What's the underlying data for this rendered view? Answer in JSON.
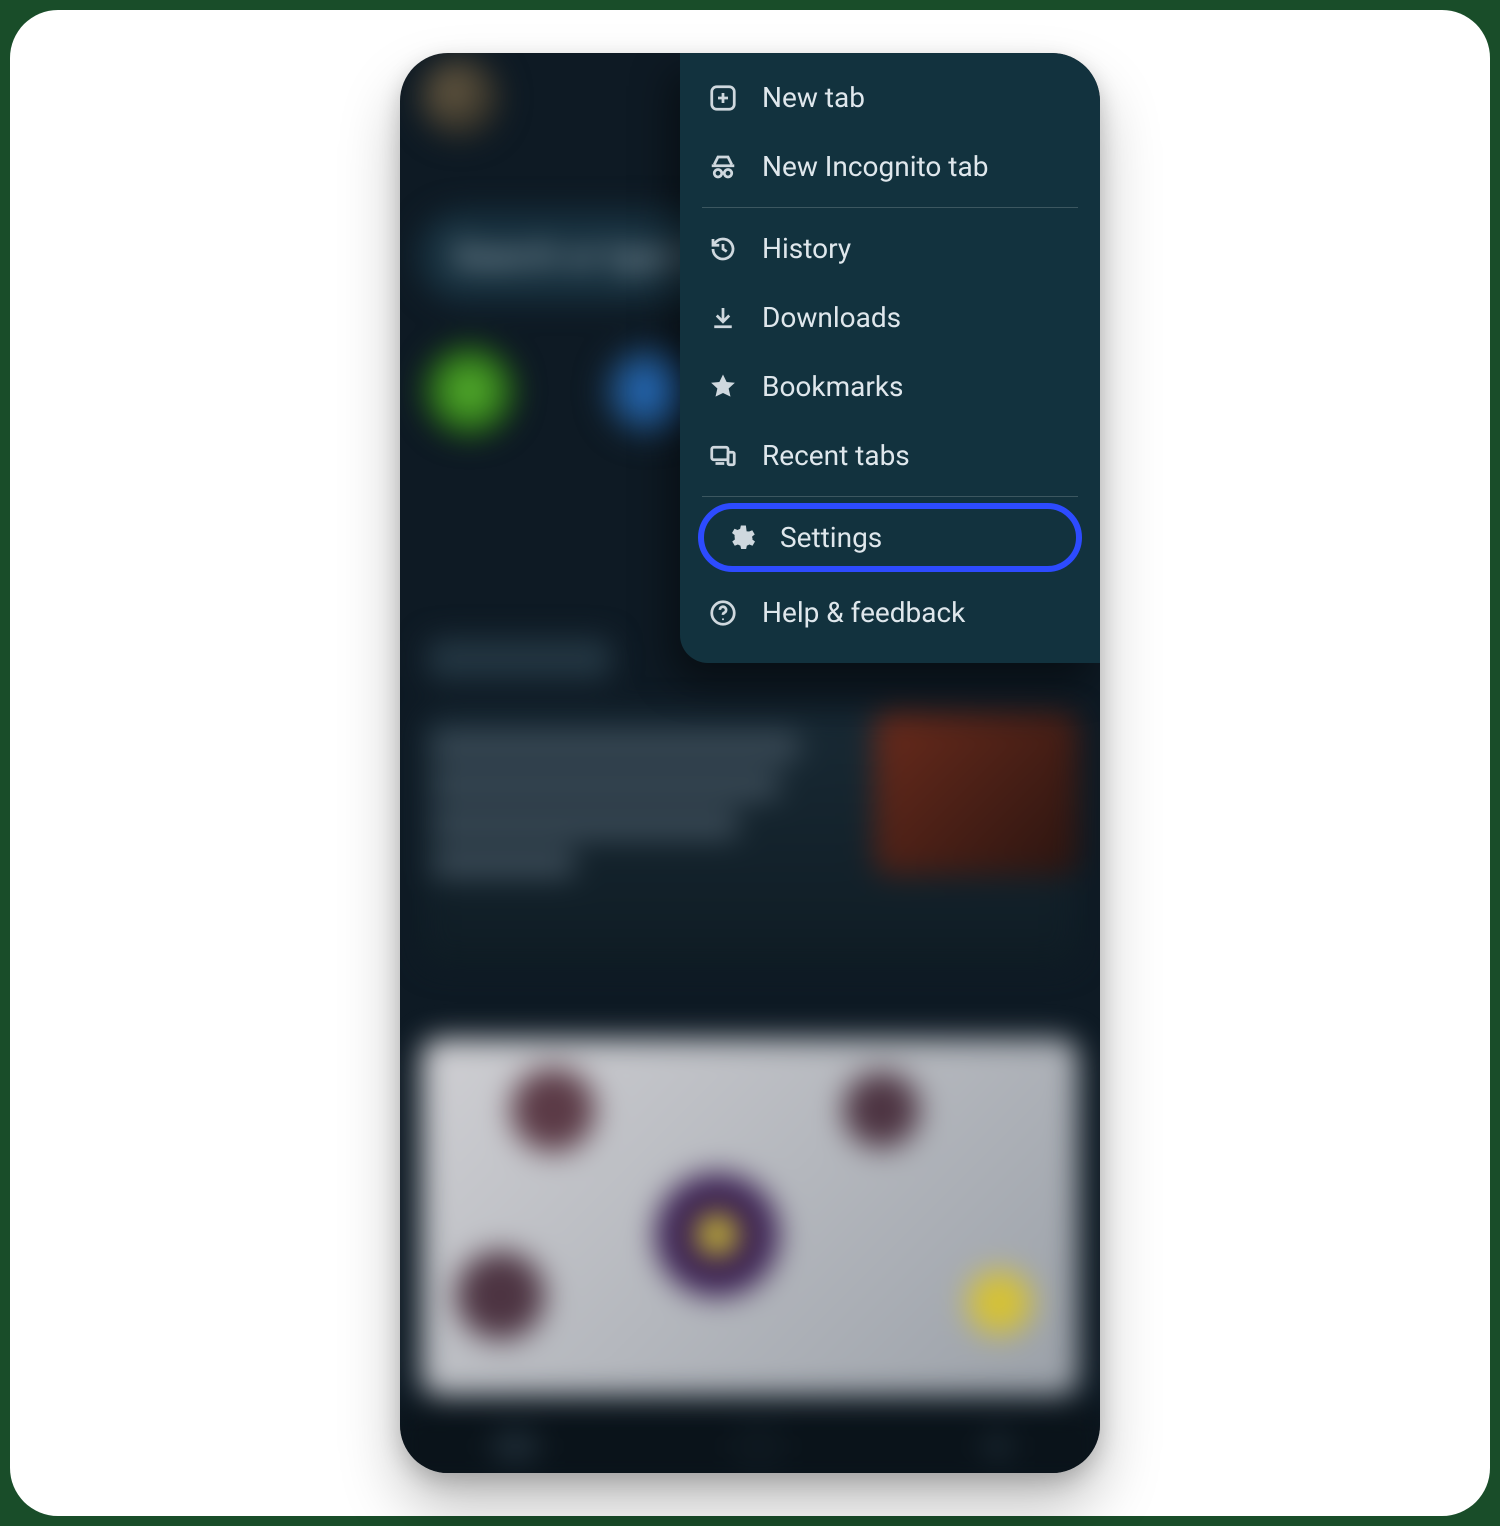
{
  "search": {
    "placeholder": "Search or type URL"
  },
  "menu": {
    "new_tab": "New tab",
    "new_incognito": "New Incognito tab",
    "history": "History",
    "downloads": "Downloads",
    "bookmarks": "Bookmarks",
    "recent_tabs": "Recent tabs",
    "settings": "Settings",
    "help_feedback": "Help & feedback"
  },
  "highlight_color": "#2d4bff"
}
